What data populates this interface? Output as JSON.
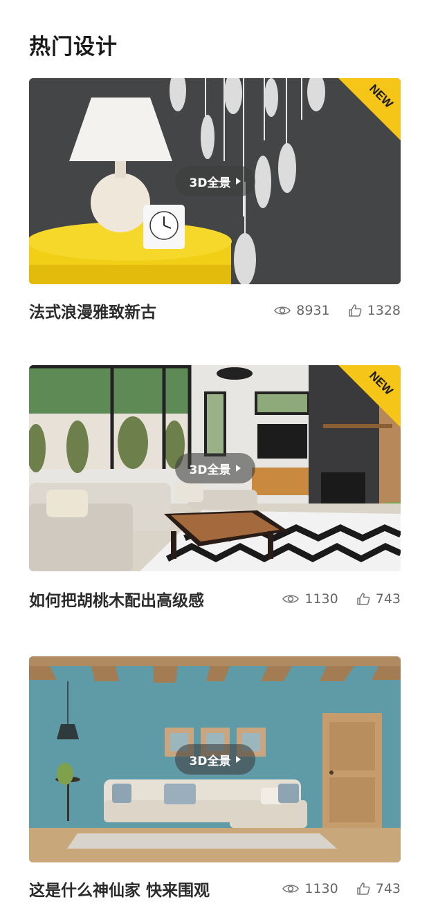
{
  "section": {
    "title": "热门设计"
  },
  "cards": [
    {
      "title": "法式浪漫雅致新古",
      "badge": "NEW",
      "pano_label": "3D全景",
      "views": "8931",
      "likes": "1328"
    },
    {
      "title": "如何把胡桃木配出高级感",
      "badge": "NEW",
      "pano_label": "3D全景",
      "views": "1130",
      "likes": "743"
    },
    {
      "title": "这是什么神仙家 快来围观",
      "badge": "",
      "pano_label": "3D全景",
      "views": "1130",
      "likes": "743"
    }
  ],
  "colors": {
    "badge": "#f5c518",
    "title": "#1a1a1a",
    "stat_text": "#666666"
  },
  "icons": {
    "views": "eye-icon",
    "likes": "thumbs-up-icon",
    "pano": "play-icon"
  }
}
